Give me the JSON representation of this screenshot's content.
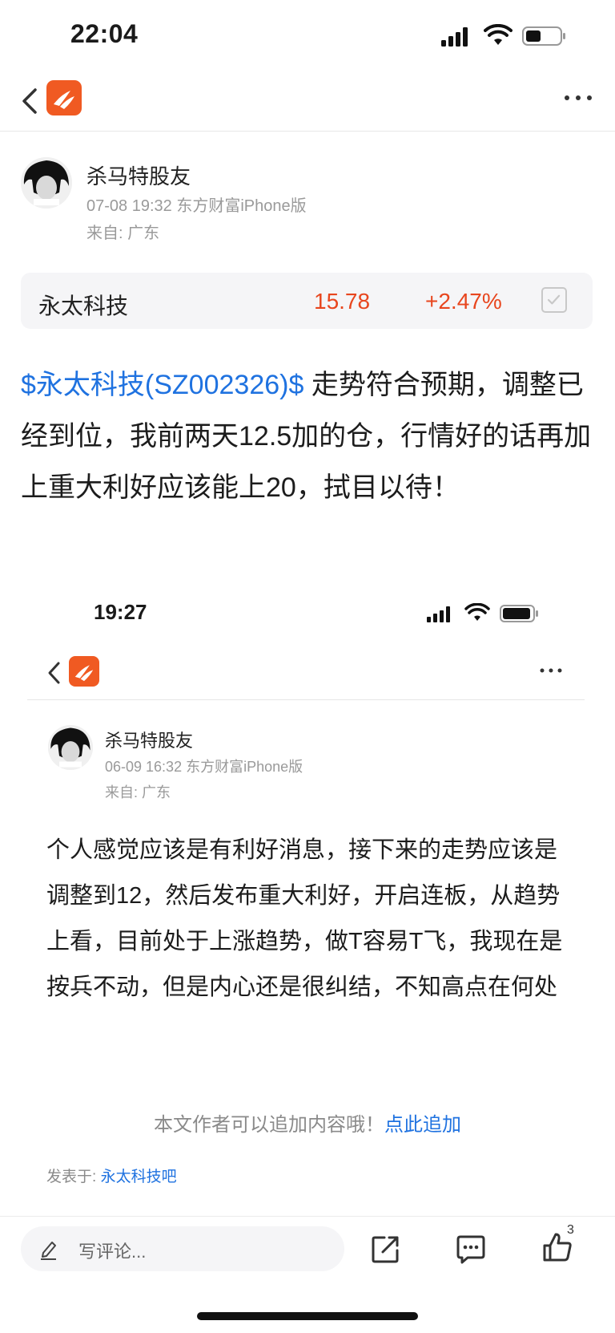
{
  "status_bar": {
    "time": "22:04"
  },
  "post": {
    "author": "杀马特股友",
    "meta": "07-08 19:32 东方财富iPhone版",
    "location": "来自: 广东",
    "stock": {
      "name": "永太科技",
      "price": "15.78",
      "change": "+2.47%"
    },
    "stock_link": "$永太科技(SZ002326)$",
    "body": "  走势符合预期，调整已经到位，我前两天12.5加的仓，行情好的话再加上重大利好应该能上20，拭目以待！"
  },
  "embedded": {
    "time": "19:27",
    "author": "杀马特股友",
    "meta": "06-09 16:32 东方财富iPhone版",
    "location": "来自: 广东",
    "body": "个人感觉应该是有利好消息，接下来的走势应该是调整到12，然后发布重大利好，开启连板，从趋势上看，目前处于上涨趋势，做T容易T飞，我现在是按兵不动，但是内心还是很纠结，不知高点在何处",
    "append_text": "本文作者可以追加内容哦！",
    "append_link": "点此追加",
    "posted_label": "发表于: ",
    "posted_forum": "永太科技吧"
  },
  "bottom_bar": {
    "comment_placeholder": "写评论...",
    "like_count": "3"
  },
  "colors": {
    "brand": "#f05a22",
    "link": "#1f72e0",
    "up": "#e8461e"
  },
  "icons": [
    "back-icon",
    "app-logo-icon",
    "more-icon",
    "signal-icon",
    "wifi-icon",
    "battery-icon",
    "checkbox-icon",
    "pencil-icon",
    "share-icon",
    "comment-icon",
    "like-icon"
  ]
}
